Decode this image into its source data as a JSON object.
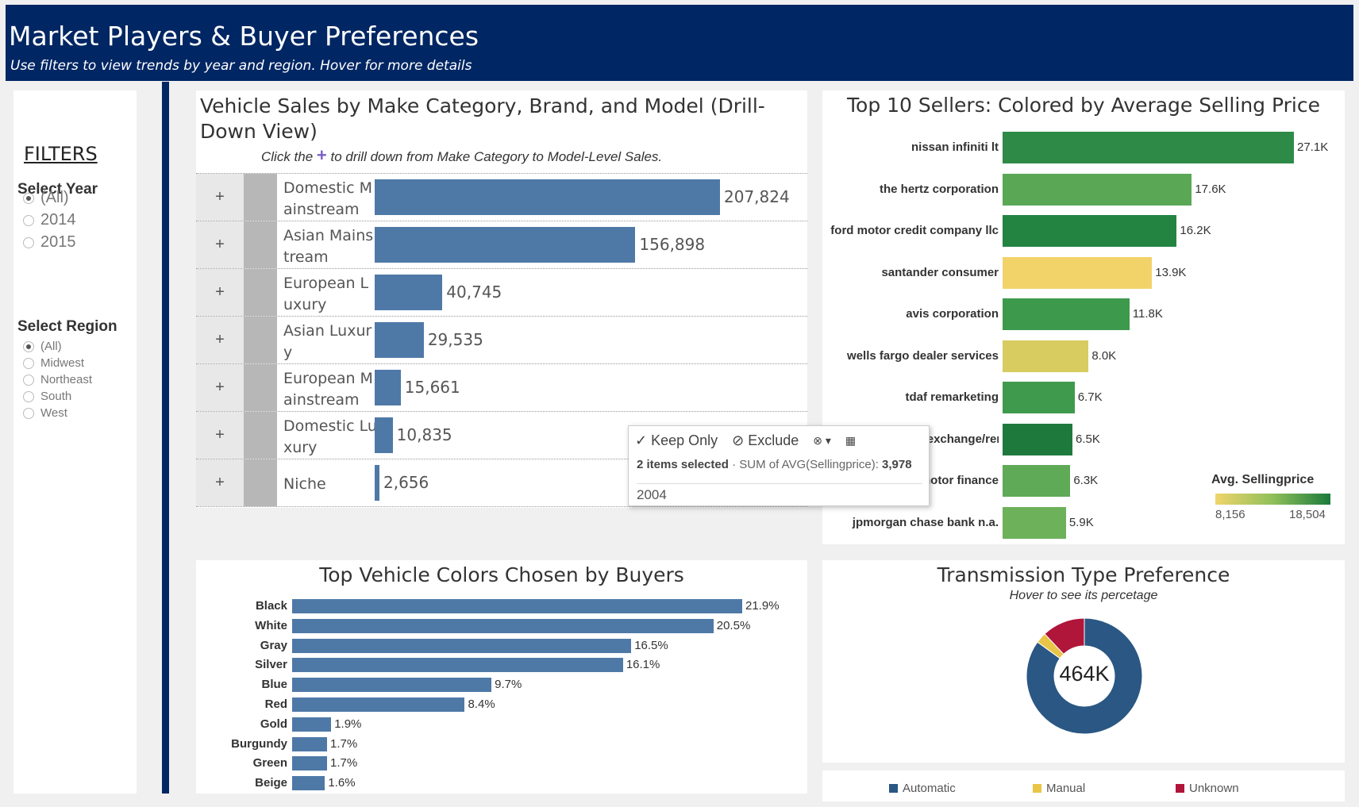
{
  "header": {
    "title": "Market Players & Buyer Preferences",
    "subtitle": "Use filters to view trends by year and region. Hover for more details"
  },
  "filters": {
    "title": "FILTERS",
    "year_label": "Select Year",
    "years": [
      "(All)",
      "2014",
      "2015"
    ],
    "year_selected": "(All)",
    "region_label": "Select Region",
    "regions": [
      "(All)",
      "Midwest",
      "Northeast",
      "South",
      "West"
    ],
    "region_selected": "(All)"
  },
  "drilldown": {
    "title": "Vehicle Sales by Make Category, Brand, and Model (Drill-Down View)",
    "subtitle_pre": "Click the",
    "subtitle_plus": "+",
    "subtitle_post": "to drill down from Make Category to Model-Level Sales.",
    "expand_symbol": "+",
    "rows": [
      {
        "label": "Domestic Mainstream",
        "value": 207824,
        "display": "207,824"
      },
      {
        "label": "Asian Mainstream",
        "value": 156898,
        "display": "156,898"
      },
      {
        "label": "European Luxury",
        "value": 40745,
        "display": "40,745"
      },
      {
        "label": "Asian Luxury",
        "value": 29535,
        "display": "29,535"
      },
      {
        "label": "European Mainstream",
        "value": 15661,
        "display": "15,661"
      },
      {
        "label": "Domestic Luxury",
        "value": 10835,
        "display": "10,835"
      },
      {
        "label": "Niche",
        "value": 2656,
        "display": "2,656"
      }
    ]
  },
  "tooltip": {
    "keep_only": "✓ Keep Only",
    "exclude": "⊘ Exclude",
    "items_selected": "2 items selected",
    "measure_label": "SUM of AVG(Sellingprice):",
    "measure_value": "3,978",
    "year": "2004"
  },
  "sellers": {
    "title": "Top 10 Sellers: Colored by  Average Selling Price",
    "legend_title": "Avg. Sellingprice",
    "legend_min": "8,156",
    "legend_max": "18,504",
    "color_low": "#f0d56b",
    "color_high": "#1a7a3c",
    "rows": [
      {
        "name": "nissan infiniti lt",
        "value": 27.1,
        "display": "27.1K",
        "color": "#2e8b47"
      },
      {
        "name": "the hertz corporation",
        "value": 17.6,
        "display": "17.6K",
        "color": "#5aa756"
      },
      {
        "name": "ford motor credit company llc",
        "value": 16.2,
        "display": "16.2K",
        "color": "#238442"
      },
      {
        "name": "santander consumer",
        "value": 13.9,
        "display": "13.9K",
        "color": "#f2d36a"
      },
      {
        "name": "avis corporation",
        "value": 11.8,
        "display": "11.8K",
        "color": "#3d9a4c"
      },
      {
        "name": "wells fargo dealer services",
        "value": 8.0,
        "display": "8.0K",
        "color": "#d8cc60"
      },
      {
        "name": "tdaf remarketing",
        "value": 6.7,
        "display": "6.7K",
        "color": "#3f9a4d"
      },
      {
        "name": "enterprise vehicle exchange/rental",
        "value": 6.5,
        "display": "6.5K",
        "color": "#1e7a3c"
      },
      {
        "name": "motor finance",
        "value": 6.3,
        "display": "6.3K",
        "color": "#5faa56"
      },
      {
        "name": "jpmorgan chase bank n.a.",
        "value": 5.9,
        "display": "5.9K",
        "color": "#6db15b"
      }
    ]
  },
  "colors": {
    "title": "Top Vehicle Colors Chosen by Buyers",
    "rows": [
      {
        "name": "Black",
        "value": 21.9,
        "display": "21.9%"
      },
      {
        "name": "White",
        "value": 20.5,
        "display": "20.5%"
      },
      {
        "name": "Gray",
        "value": 16.5,
        "display": "16.5%"
      },
      {
        "name": "Silver",
        "value": 16.1,
        "display": "16.1%"
      },
      {
        "name": "Blue",
        "value": 9.7,
        "display": "9.7%"
      },
      {
        "name": "Red",
        "value": 8.4,
        "display": "8.4%"
      },
      {
        "name": "Gold",
        "value": 1.9,
        "display": "1.9%"
      },
      {
        "name": "Burgundy",
        "value": 1.7,
        "display": "1.7%"
      },
      {
        "name": "Green",
        "value": 1.7,
        "display": "1.7%"
      },
      {
        "name": "Beige",
        "value": 1.6,
        "display": "1.6%"
      }
    ]
  },
  "transmission": {
    "title": "Transmission Type Preference",
    "subtitle": "Hover to see its percetage",
    "center_label": "464K",
    "slices": [
      {
        "name": "Automatic",
        "fraction": 0.85,
        "color": "#2a5783"
      },
      {
        "name": "Manual",
        "fraction": 0.03,
        "color": "#e8c547"
      },
      {
        "name": "Unknown",
        "fraction": 0.12,
        "color": "#b0153a"
      }
    ]
  },
  "chart_data": [
    {
      "type": "bar",
      "title": "Vehicle Sales by Make Category, Brand, and Model (Drill-Down View)",
      "categories": [
        "Domestic Mainstream",
        "Asian Mainstream",
        "European Luxury",
        "Asian Luxury",
        "European Mainstream",
        "Domestic Luxury",
        "Niche"
      ],
      "values": [
        207824,
        156898,
        40745,
        29535,
        15661,
        10835,
        2656
      ]
    },
    {
      "type": "bar",
      "title": "Top 10 Sellers: Colored by  Average Selling Price",
      "categories": [
        "nissan infiniti lt",
        "the hertz corporation",
        "ford motor credit company llc",
        "santander consumer",
        "avis corporation",
        "wells fargo dealer services",
        "tdaf remarketing",
        "enterprise vehicle exchange/rental",
        "motor finance",
        "jpmorgan chase bank n.a."
      ],
      "values": [
        27.1,
        17.6,
        16.2,
        13.9,
        11.8,
        8.0,
        6.7,
        6.5,
        6.3,
        5.9
      ]
    },
    {
      "type": "bar",
      "title": "Top Vehicle Colors Chosen by Buyers",
      "categories": [
        "Black",
        "White",
        "Gray",
        "Silver",
        "Blue",
        "Red",
        "Gold",
        "Burgundy",
        "Green",
        "Beige"
      ],
      "values": [
        21.9,
        20.5,
        16.5,
        16.1,
        9.7,
        8.4,
        1.9,
        1.7,
        1.7,
        1.6
      ]
    },
    {
      "type": "pie",
      "title": "Transmission Type Preference",
      "categories": [
        "Automatic",
        "Manual",
        "Unknown"
      ],
      "values": [
        0.85,
        0.03,
        0.12
      ]
    }
  ]
}
